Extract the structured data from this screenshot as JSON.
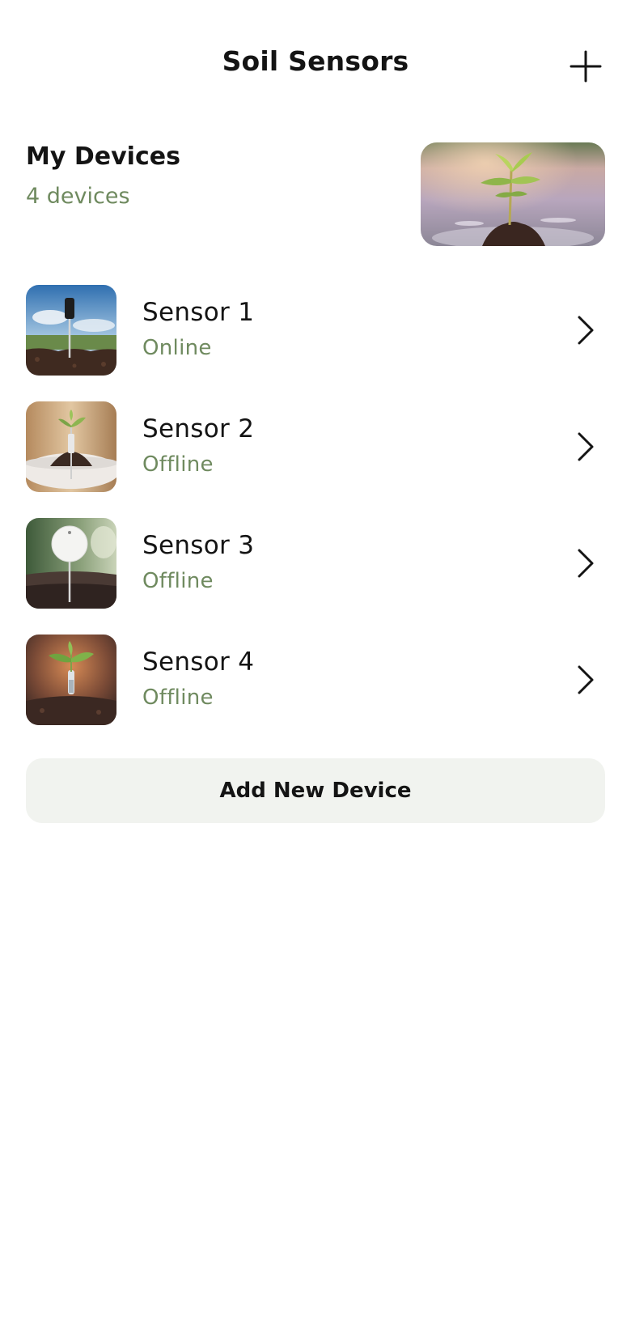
{
  "header": {
    "title": "Soil Sensors",
    "add_icon": "plus-icon"
  },
  "summary": {
    "title": "My Devices",
    "count": "4 devices",
    "image": "seedling-in-soil-photo"
  },
  "devices": [
    {
      "name": "Sensor 1",
      "status": "Online",
      "image": "soil-probe-sky-photo"
    },
    {
      "name": "Sensor 2",
      "status": "Offline",
      "image": "seedling-probe-photo"
    },
    {
      "name": "Sensor 3",
      "status": "Offline",
      "image": "round-sensor-photo"
    },
    {
      "name": "Sensor 4",
      "status": "Offline",
      "image": "plant-probe-photo"
    }
  ],
  "actions": {
    "add_device_label": "Add New Device"
  },
  "colors": {
    "text": "#141414",
    "muted_green": "#6f8a5f",
    "button_bg": "#f1f3ef",
    "background": "#ffffff"
  }
}
